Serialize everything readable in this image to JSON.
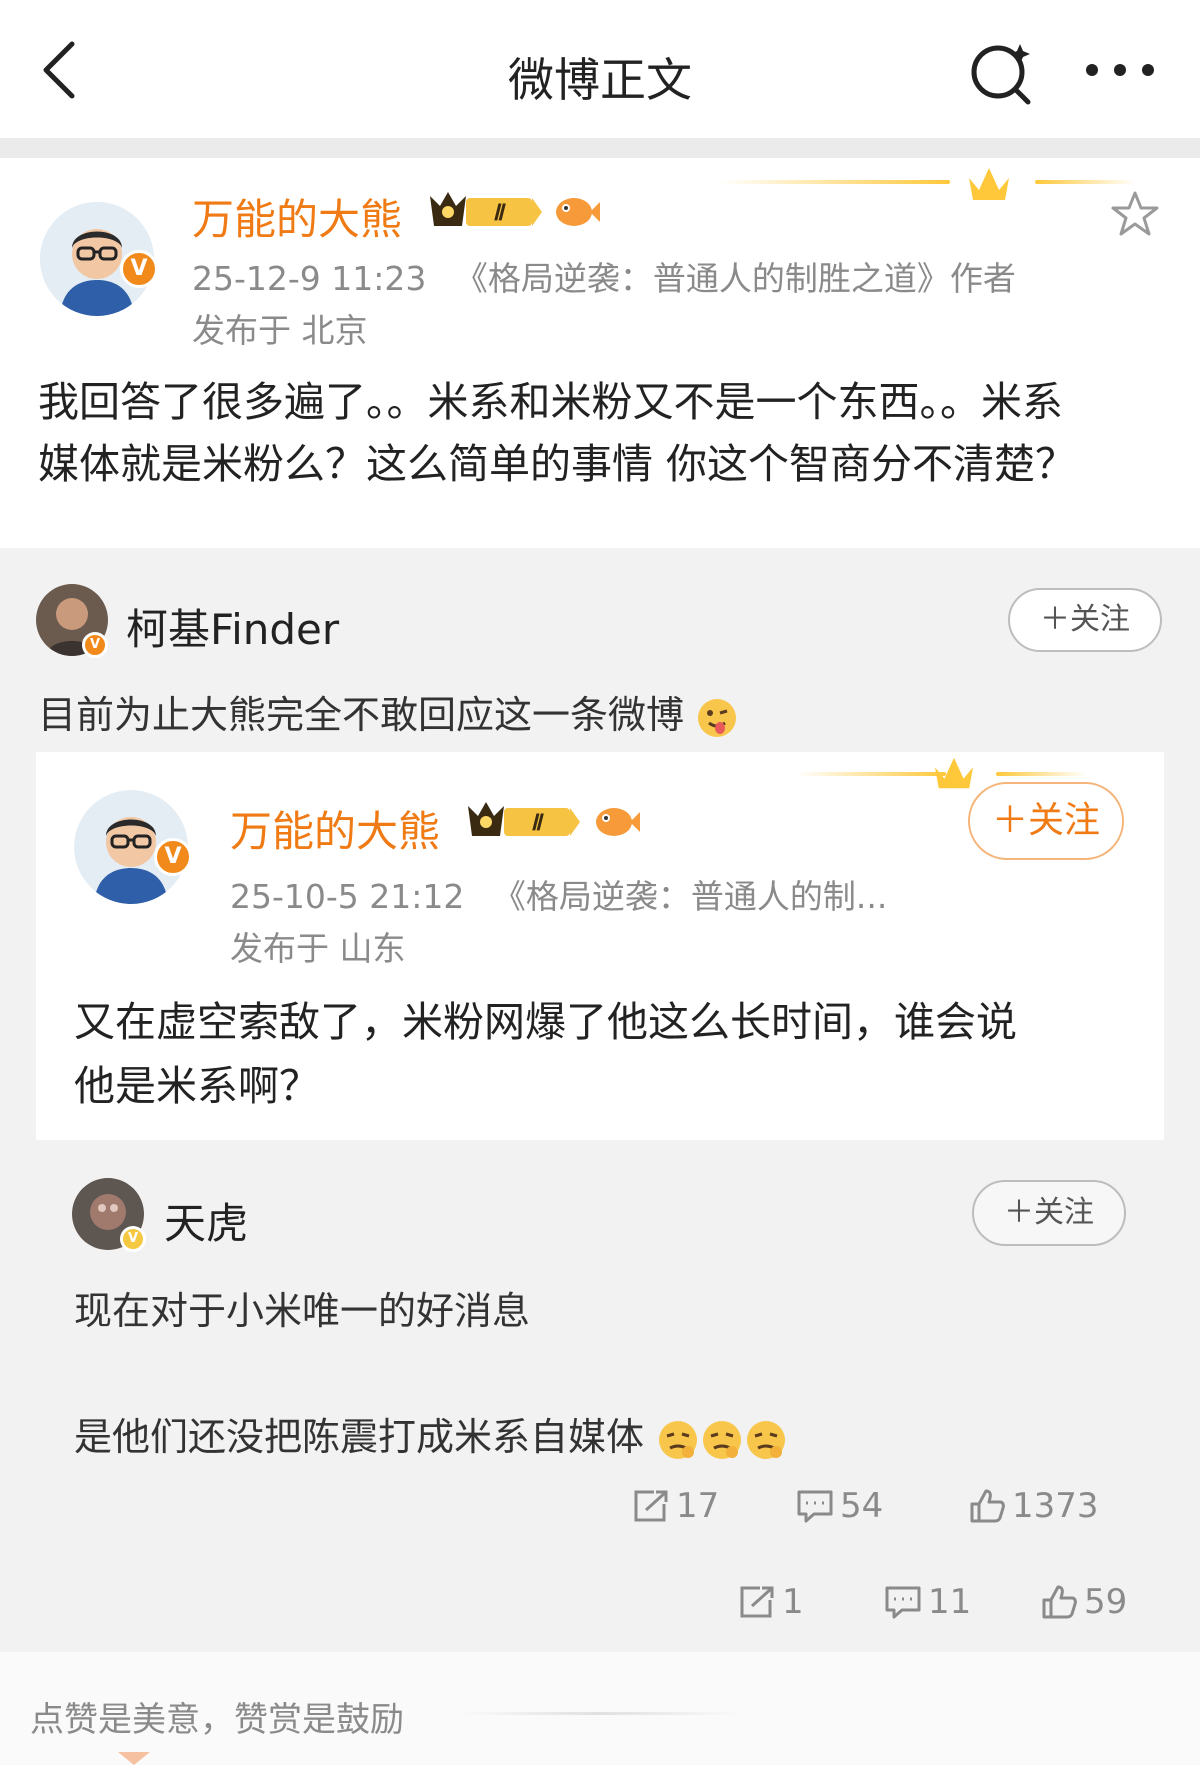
{
  "header": {
    "title": "微博正文",
    "icons": [
      "back-icon",
      "search-icon",
      "more-icon"
    ]
  },
  "post": {
    "author": "万能的大熊",
    "level_badge": "Ⅱ",
    "time": "25-12-9 11:23",
    "desc": "《格局逆袭：普通人的制胜之道》作者",
    "location": "发布于 北京",
    "text_line1": "我回答了很多遍了。。米系和米粉又不是一个东西。。米系",
    "text_line2": "媒体就是米粉么？这么简单的事情 你这个智商分不清楚？"
  },
  "repost": {
    "author": "柯基Finder",
    "follow": "＋关注",
    "text": "目前为止大熊完全不敢回应这一条微博",
    "quote": {
      "author": "万能的大熊",
      "level_badge": "Ⅱ",
      "follow": "＋关注",
      "time": "25-10-5 21:12",
      "desc": "《格局逆袭：普通人的制...",
      "location": "发布于 山东",
      "text_line1": "又在虚空索敌了，米粉网爆了他这么长时间，谁会说",
      "text_line2": "他是米系啊？"
    },
    "inner": {
      "author": "天虎",
      "follow": "＋关注",
      "text_line1": "现在对于小米唯一的好消息",
      "text_line2": "是他们还没把陈震打成米系自媒体",
      "reposts": "17",
      "comments": "54",
      "likes": "1373"
    },
    "reposts": "1",
    "comments": "11",
    "likes": "59"
  },
  "footer": {
    "text": "点赞是美意，赞赏是鼓励"
  },
  "colors": {
    "accent": "#f07a14",
    "vip_gold": "#ffc83a",
    "gray_text": "#8a8a8a"
  }
}
